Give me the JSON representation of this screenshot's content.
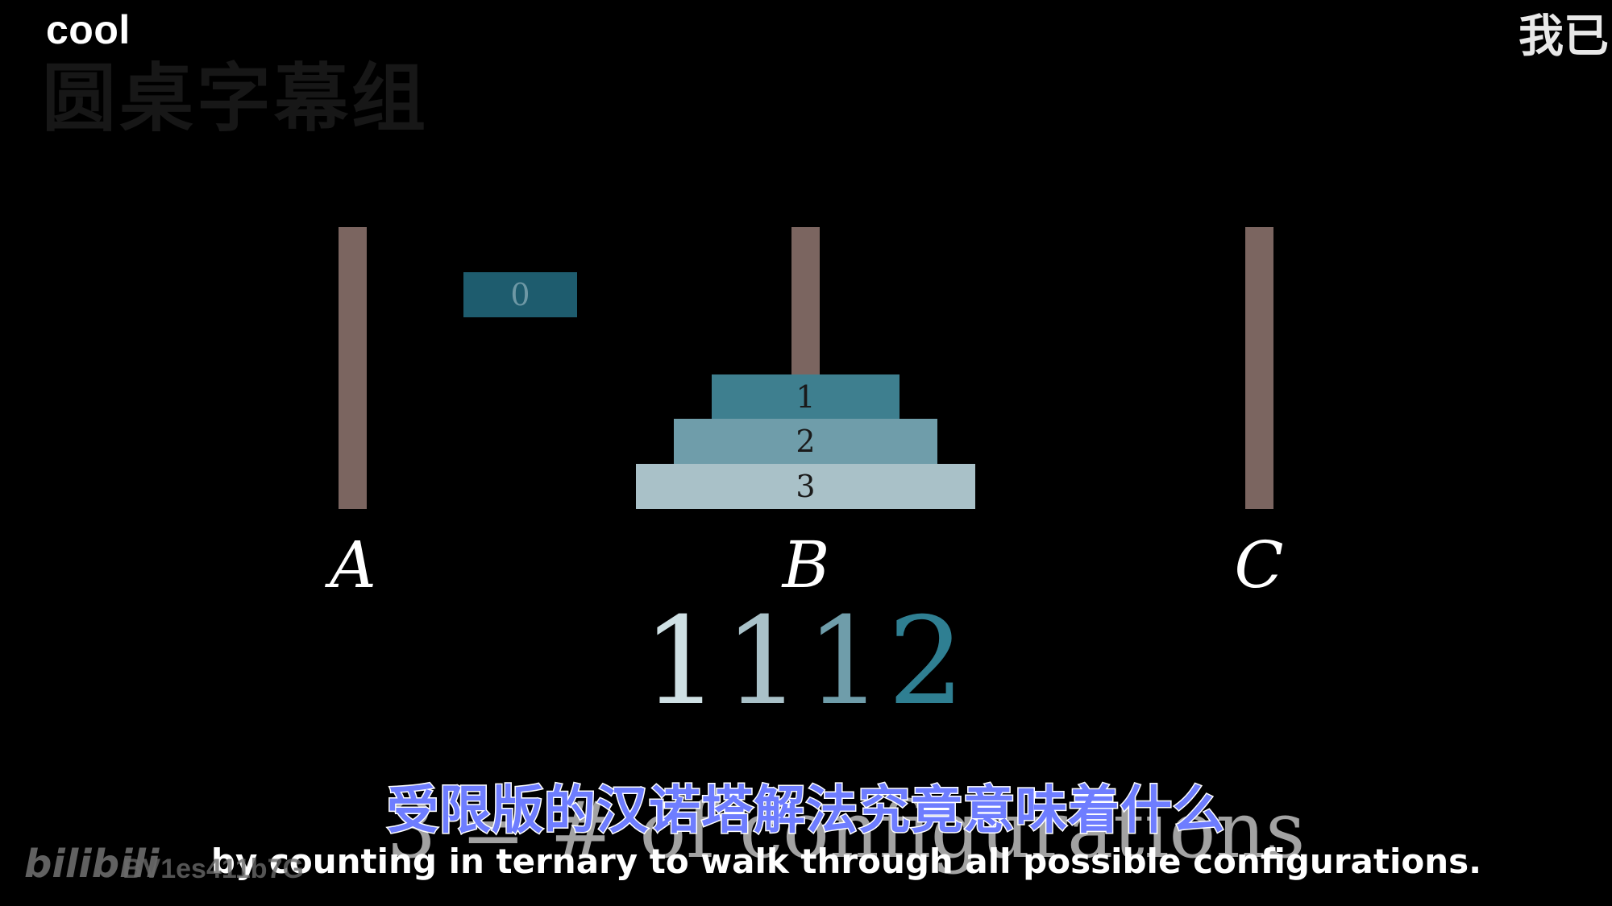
{
  "header": {
    "corner_left": "cool",
    "corner_right": "我已",
    "fansub_watermark": "圆桌字幕组"
  },
  "scene": {
    "rods": [
      {
        "label": "A"
      },
      {
        "label": "B"
      },
      {
        "label": "C"
      }
    ],
    "disks": [
      {
        "number": "0",
        "color": "#1e5c6e"
      },
      {
        "number": "1",
        "color": "#3e7f8f"
      },
      {
        "number": "2",
        "color": "#6f9daa"
      },
      {
        "number": "3",
        "color": "#a9c1c8"
      }
    ],
    "rod_color": "#7b6560",
    "ternary_digits": [
      {
        "digit": "1",
        "color": "#cfe0e4"
      },
      {
        "digit": "1",
        "color": "#a9c1c8"
      },
      {
        "digit": "1",
        "color": "#6f9daa"
      },
      {
        "digit": "2",
        "color": "#2f7f92"
      }
    ],
    "ghost_text": "3 = # of configurations"
  },
  "subtitles": {
    "chinese": "受限版的汉诺塔解法究竟意味着什么",
    "english": "by counting in ternary to walk through all possible configurations."
  },
  "platform_watermark": {
    "logo": "bilibili",
    "video_id": "BV1es411b7G"
  }
}
